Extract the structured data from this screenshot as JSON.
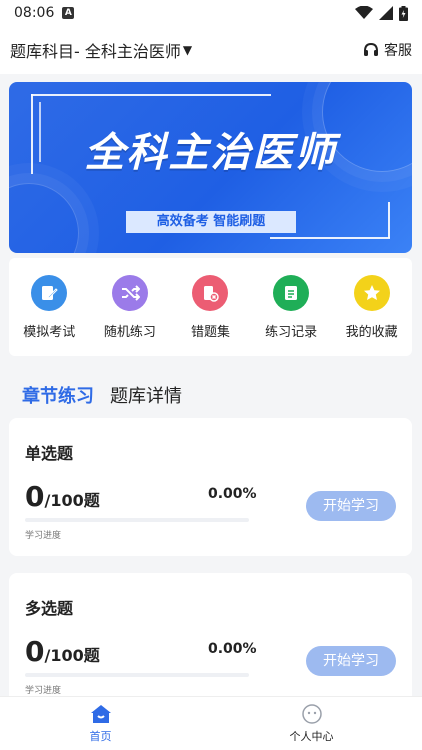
{
  "status": {
    "time": "08:06",
    "notification_badge": "A"
  },
  "header": {
    "title": "题库科目- 全科主治医师",
    "service_label": "客服"
  },
  "banner": {
    "title": "全科主治医师",
    "tagline": "高效备考 智能刷题"
  },
  "shortcuts": [
    {
      "label": "模拟考试",
      "icon": "edit-doc-icon",
      "color": "#3a8fe8"
    },
    {
      "label": "随机练习",
      "icon": "shuffle-icon",
      "color": "#9b7be9"
    },
    {
      "label": "错题集",
      "icon": "wrong-book-icon",
      "color": "#ec5d73"
    },
    {
      "label": "练习记录",
      "icon": "record-icon",
      "color": "#1fae57"
    },
    {
      "label": "我的收藏",
      "icon": "star-icon",
      "color": "#f3d21a"
    }
  ],
  "tabs": {
    "active": "章节练习",
    "other": "题库详情"
  },
  "cards": [
    {
      "title": "单选题",
      "done": "0",
      "total": "/100题",
      "percent": "0.00%",
      "progress_fraction": 0.0,
      "progress_label": "学习进度",
      "button": "开始学习"
    },
    {
      "title": "多选题",
      "done": "0",
      "total": "/100题",
      "percent": "0.00%",
      "progress_fraction": 0.0,
      "progress_label": "学习进度",
      "button": "开始学习"
    }
  ],
  "bottom_nav": [
    {
      "label": "首页",
      "active": true,
      "icon": "home-icon"
    },
    {
      "label": "个人中心",
      "active": false,
      "icon": "user-center-icon"
    }
  ],
  "colors": {
    "accent": "#2f6be6",
    "button": "#9dbaf0"
  }
}
